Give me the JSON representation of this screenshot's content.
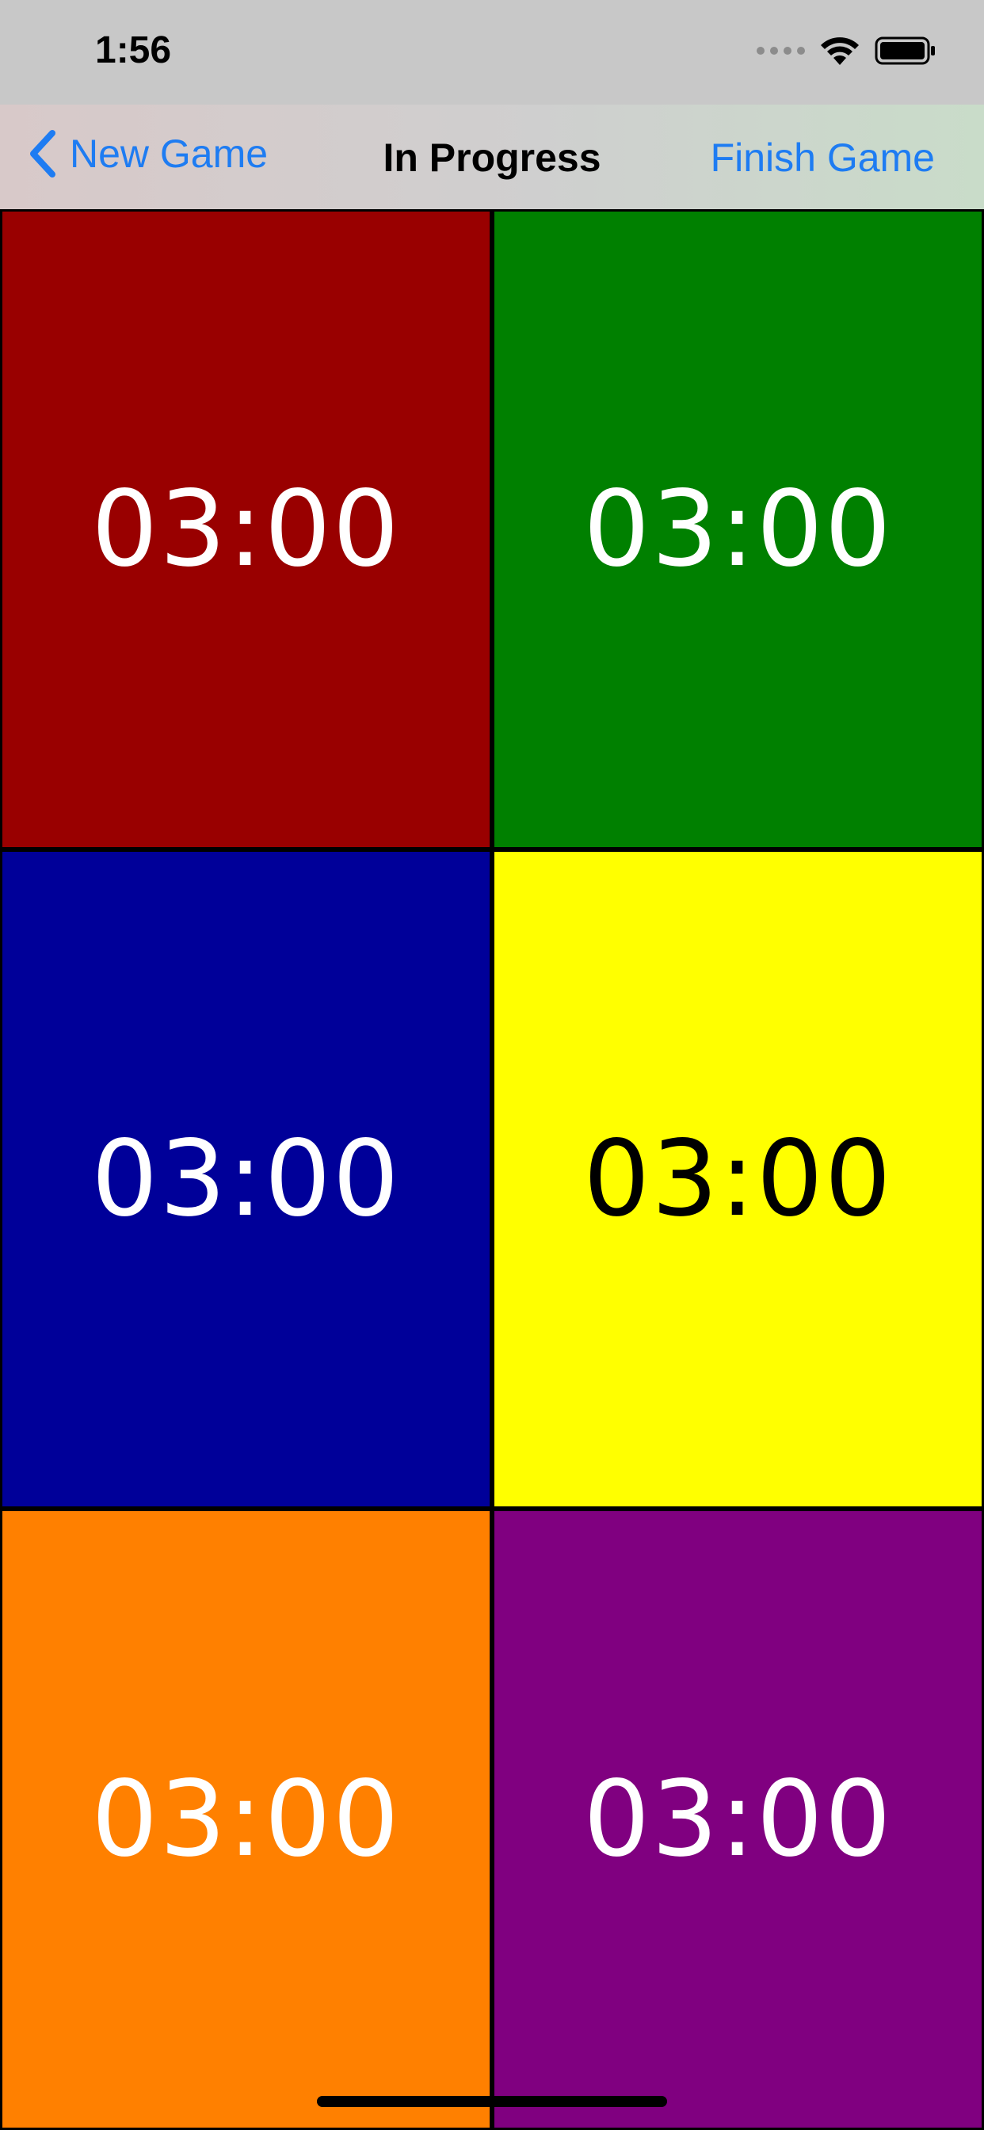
{
  "status_bar": {
    "time": "1:56"
  },
  "nav": {
    "back_label": "New Game",
    "title": "In Progress",
    "finish_label": "Finish Game"
  },
  "tiles": [
    {
      "time": "03:00",
      "bg": "#990000",
      "fg": "#ffffff"
    },
    {
      "time": "03:00",
      "bg": "#008000",
      "fg": "#ffffff"
    },
    {
      "time": "03:00",
      "bg": "#000099",
      "fg": "#ffffff"
    },
    {
      "time": "03:00",
      "bg": "#ffff00",
      "fg": "#000000"
    },
    {
      "time": "03:00",
      "bg": "#ff8000",
      "fg": "#ffffff"
    },
    {
      "time": "03:00",
      "bg": "#800080",
      "fg": "#ffffff"
    }
  ],
  "colors": {
    "accent": "#1e7cf2"
  },
  "icons": {
    "back": "chevron-left-icon",
    "wifi": "wifi-icon",
    "battery": "battery-icon",
    "signal": "cellular-signal-icon"
  }
}
